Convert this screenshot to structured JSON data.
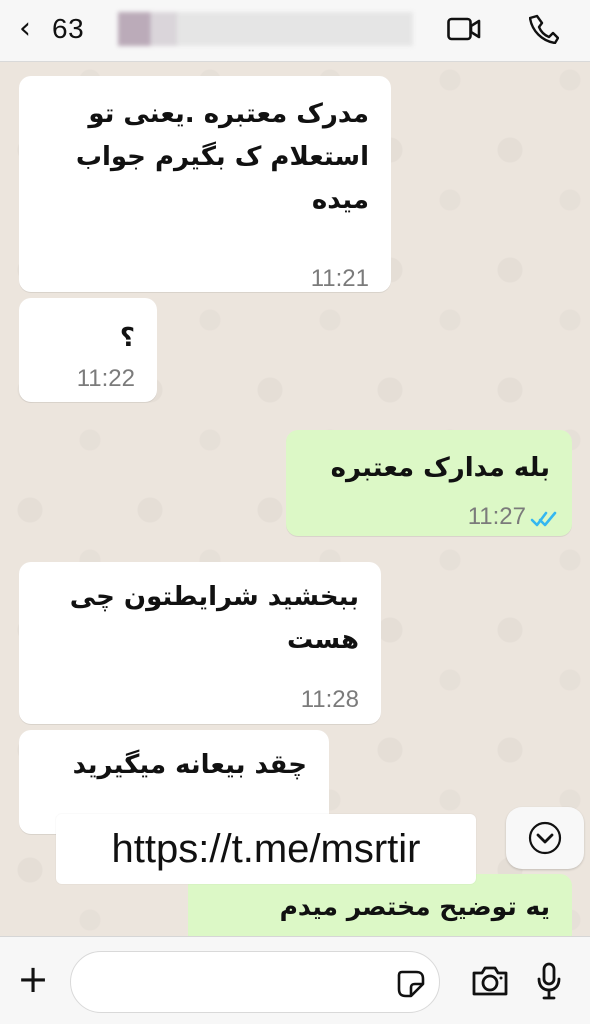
{
  "header": {
    "back_icon": "chevron-left-icon",
    "count": "63",
    "name_redacted": true,
    "video_icon": "video-camera-icon",
    "call_icon": "phone-icon"
  },
  "messages": [
    {
      "direction": "incoming",
      "text": "مدرک معتبره .یعنی تو\nاستعلام ک بگیرم جواب\nمیده",
      "time": "11:21"
    },
    {
      "direction": "incoming",
      "text": "؟",
      "time": "11:22"
    },
    {
      "direction": "outgoing",
      "text": "بله مدارک معتبره",
      "time": "11:27",
      "status_icon": "double-check-icon"
    },
    {
      "direction": "incoming",
      "text": "ببخشید شرایطتون چی\nهست",
      "time": "11:28"
    },
    {
      "direction": "incoming",
      "text": "چقد بیعانه میگیرید"
    },
    {
      "direction": "outgoing",
      "text": "یه توضیح مختصر میدم"
    }
  ],
  "overlay": {
    "watermark": "https://t.me/msrtir"
  },
  "scroll": {
    "icon": "chevron-down-icon"
  },
  "composer": {
    "plus_icon": "plus-icon",
    "input_value": "",
    "input_placeholder": "",
    "sticker_icon": "sticker-icon",
    "camera_icon": "camera-icon",
    "mic_icon": "microphone-icon"
  },
  "colors": {
    "header_bg": "#f7f7f7",
    "chat_bg": "#ece5dd",
    "incoming_bubble": "#ffffff",
    "outgoing_bubble": "#dcf8c6",
    "time_text": "#7b7b7b",
    "read_ticks": "#34b7f1"
  }
}
